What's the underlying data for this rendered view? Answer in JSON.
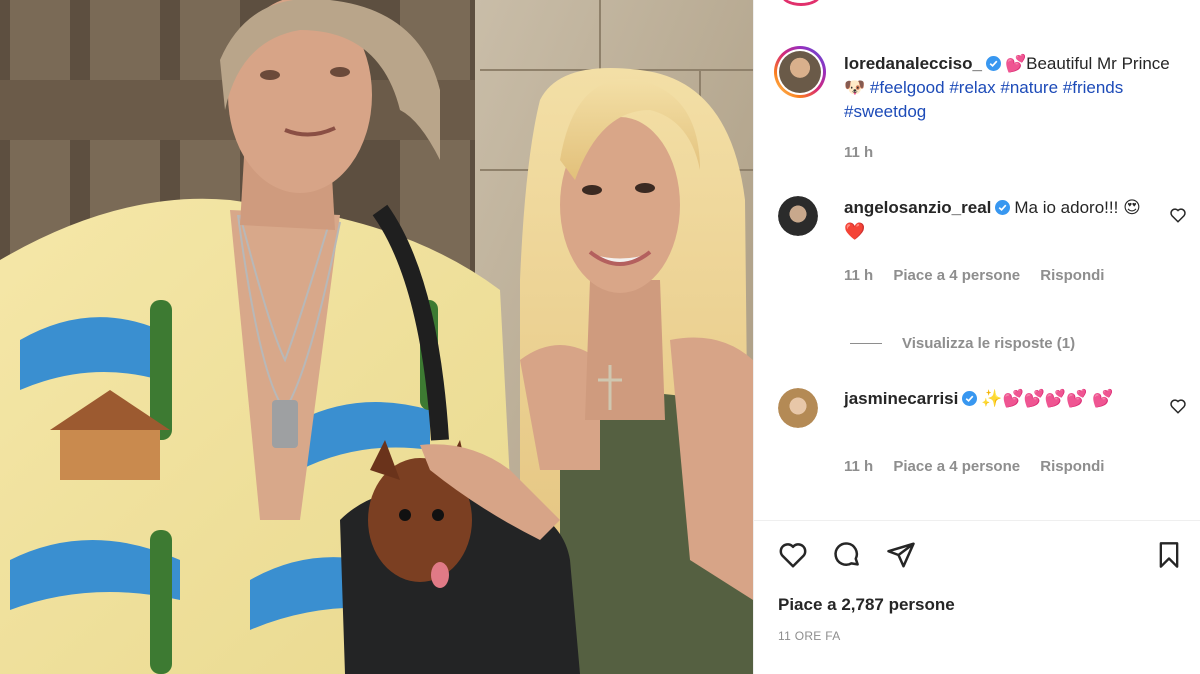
{
  "post": {
    "author": "loredanalecciso_",
    "caption_emoji": "💕",
    "caption_text": "Beautiful Mr Prince",
    "caption_dog": "🐶",
    "hashtags": [
      "#feelgood",
      "#relax",
      "#nature",
      "#friends",
      "#sweetdog"
    ],
    "time": "11 h"
  },
  "comments": [
    {
      "user": "angelosanzio_real",
      "text": "Ma io adoro!!!",
      "emoji": "😍❤️",
      "time": "11 h",
      "likes": "Piace a 4 persone",
      "reply": "Rispondi"
    },
    {
      "user": "jasminecarrisi",
      "text": "✨💕💕💕💕",
      "emoji": "💕",
      "time": "11 h",
      "likes": "Piace a 4 persone",
      "reply": "Rispondi"
    }
  ],
  "view_replies": "Visualizza le risposte (1)",
  "footer": {
    "likes": "Piace a 2,787 persone",
    "time_ago": "11 ORE FA"
  },
  "colors": {
    "verified": "#3897f0",
    "hashtag": "#1d4bb8",
    "muted": "#8e8e8e"
  },
  "icons": [
    "heart-icon",
    "comment-icon",
    "share-icon",
    "bookmark-icon",
    "verified-icon"
  ]
}
